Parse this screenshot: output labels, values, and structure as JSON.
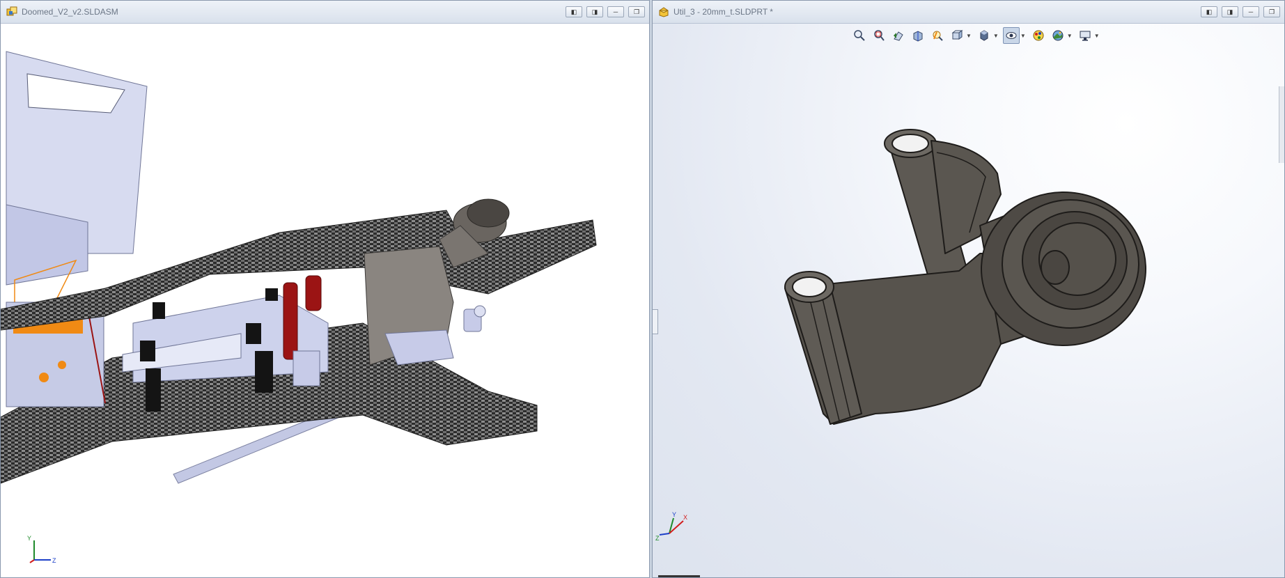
{
  "windows": {
    "left": {
      "title": "Doomed_V2_v2.SLDASM",
      "doc_type": "assembly",
      "triad_labels": {
        "y": "Y",
        "z": "Z"
      }
    },
    "right": {
      "title": "Util_3 - 20mm_t.SLDPRT *",
      "doc_type": "part",
      "triad_labels": {
        "y": "Y",
        "x": "X",
        "z": "Z"
      }
    }
  },
  "window_controls": [
    "tile-left-icon",
    "tile-right-icon",
    "minimize-icon",
    "restore-icon"
  ],
  "heads_up_toolbar": [
    {
      "icon": "zoom-to-fit-icon",
      "dropdown": false,
      "active": false
    },
    {
      "icon": "zoom-to-area-icon",
      "dropdown": false,
      "active": false
    },
    {
      "icon": "previous-view-icon",
      "dropdown": false,
      "active": false
    },
    {
      "icon": "section-view-icon",
      "dropdown": false,
      "active": false
    },
    {
      "icon": "dynamic-annotation-icon",
      "dropdown": false,
      "active": false
    },
    {
      "icon": "view-orientation-icon",
      "dropdown": true,
      "active": false
    },
    {
      "icon": "display-style-icon",
      "dropdown": true,
      "active": false
    },
    {
      "icon": "hide-show-items-icon",
      "dropdown": true,
      "active": true
    },
    {
      "icon": "edit-appearance-icon",
      "dropdown": false,
      "active": false
    },
    {
      "icon": "apply-scene-icon",
      "dropdown": true,
      "active": false
    },
    {
      "icon": "view-settings-icon",
      "dropdown": true,
      "active": false
    }
  ],
  "colors": {
    "part_body": "#5d5953",
    "part_edge": "#1e1c1a",
    "carbon_plate": "#3a3a3a",
    "frame_metal": "#c8cde8",
    "standoff_red": "#9b1414",
    "accent_orange": "#f08a14",
    "triad_x": "#d21d1d",
    "triad_y": "#1e8a2a",
    "triad_z": "#1c3fc8"
  }
}
